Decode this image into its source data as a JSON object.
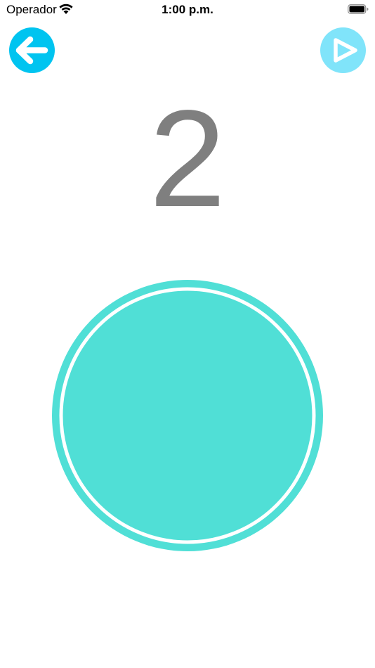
{
  "status_bar": {
    "carrier": "Operador",
    "time": "1:00 p.m.",
    "icons": [
      "wifi-icon",
      "battery-icon"
    ]
  },
  "toolbar": {
    "back_icon": "arrow-left-icon",
    "play_icon": "play-icon"
  },
  "counter": {
    "value": "2"
  },
  "colors": {
    "back_button": "#00c4f0",
    "play_button": "#80e4fa",
    "circle": "#50dfd6",
    "counter_text": "#7f7f7f"
  }
}
